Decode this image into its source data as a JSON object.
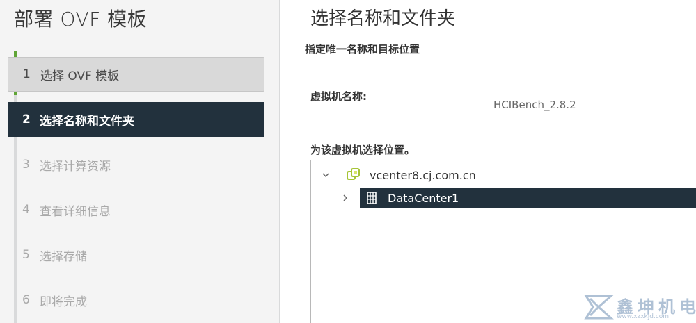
{
  "wizard": {
    "title": "部署 OVF 模板",
    "steps": [
      {
        "num": "1",
        "label": "选择 OVF 模板",
        "state": "completed"
      },
      {
        "num": "2",
        "label": "选择名称和文件夹",
        "state": "active"
      },
      {
        "num": "3",
        "label": "选择计算资源",
        "state": "pending"
      },
      {
        "num": "4",
        "label": "查看详细信息",
        "state": "pending"
      },
      {
        "num": "5",
        "label": "选择存储",
        "state": "pending"
      },
      {
        "num": "6",
        "label": "即将完成",
        "state": "pending"
      }
    ]
  },
  "main": {
    "title": "选择名称和文件夹",
    "subtitle": "指定唯一名称和目标位置",
    "vm_name_label": "虚拟机名称:",
    "vm_name_value": "HCIBench_2.8.2",
    "location_label": "为该虚拟机选择位置。",
    "tree": {
      "root": {
        "label": "vcenter8.cj.com.cn",
        "icon": "vcenter-icon",
        "expanded": true
      },
      "children": [
        {
          "label": "DataCenter1",
          "icon": "datacenter-icon",
          "expanded": false,
          "selected": true
        }
      ]
    }
  },
  "watermark": {
    "text": "鑫坤机电",
    "url": "www.xzxkjd.com"
  },
  "colors": {
    "active_step_bg": "#22313d",
    "completed_accent": "#60a536",
    "selected_node_bg": "#22313d"
  }
}
